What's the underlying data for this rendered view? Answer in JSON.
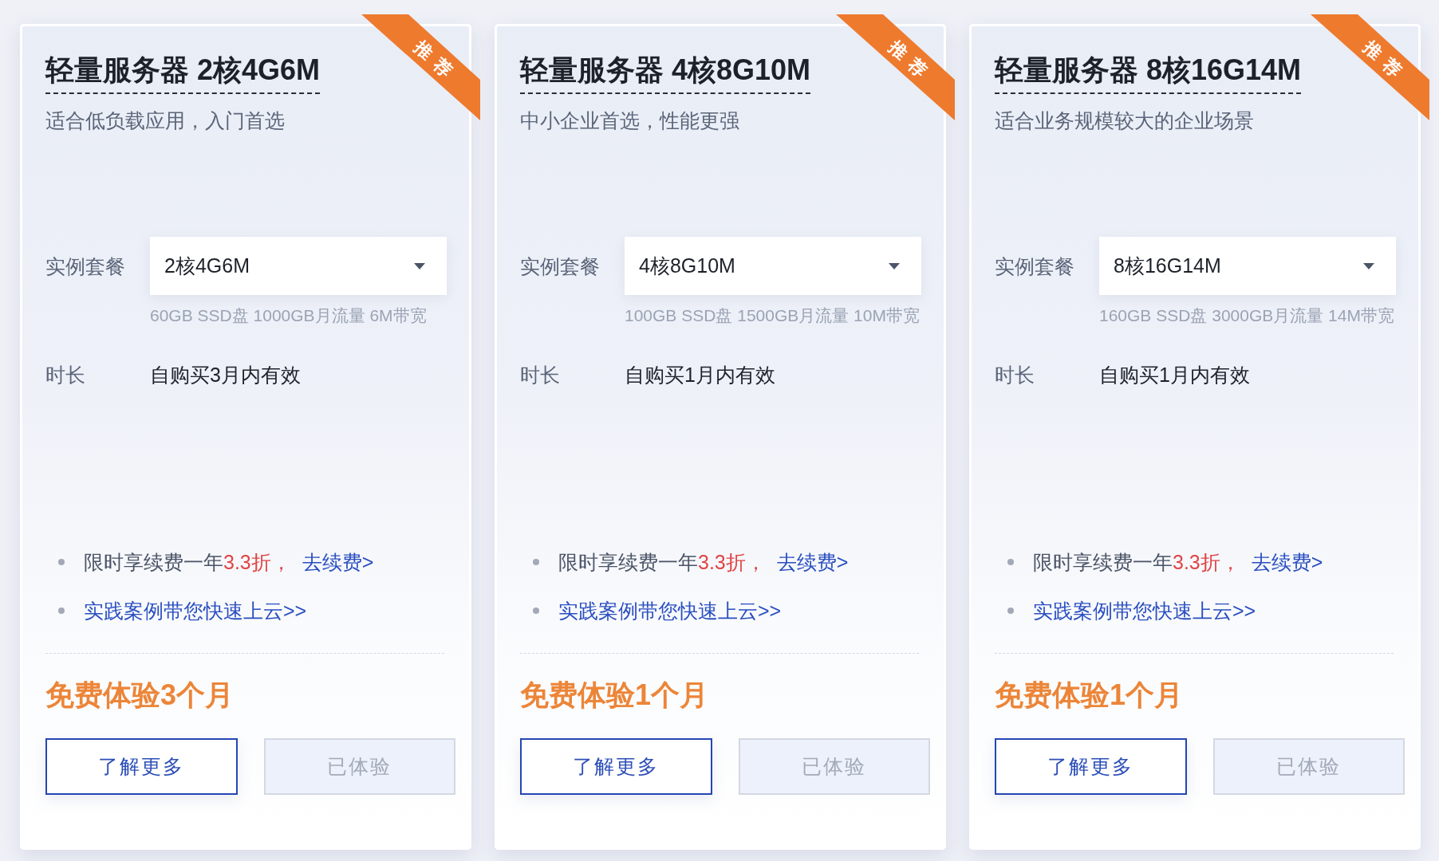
{
  "plans": [
    {
      "title": "轻量服务器 2核4G6M",
      "badge": "推荐",
      "subtitle": "适合低负载应用，入门首选",
      "package": {
        "label": "实例套餐",
        "value": "2核4G6M",
        "note": "60GB SSD盘 1000GB月流量 6M带宽"
      },
      "duration": {
        "label": "时长",
        "value": "自购买3月内有效"
      },
      "perks": [
        {
          "text": "限时享续费一年",
          "highlight": "3.3折，",
          "link": "去续费>"
        },
        {
          "link": "实践案例带您快速上云>>"
        }
      ],
      "offer": "免费体验3个月",
      "buttons": [
        {
          "label": "了解更多",
          "disabled": false
        },
        {
          "label": "已体验",
          "disabled": true
        }
      ]
    },
    {
      "title": "轻量服务器 4核8G10M",
      "badge": "推荐",
      "subtitle": "中小企业首选，性能更强",
      "package": {
        "label": "实例套餐",
        "value": "4核8G10M",
        "note": "100GB SSD盘 1500GB月流量 10M带宽"
      },
      "duration": {
        "label": "时长",
        "value": "自购买1月内有效"
      },
      "perks": [
        {
          "text": "限时享续费一年",
          "highlight": "3.3折，",
          "link": "去续费>"
        },
        {
          "link": "实践案例带您快速上云>>"
        }
      ],
      "offer": "免费体验1个月",
      "buttons": [
        {
          "label": "了解更多",
          "disabled": false
        },
        {
          "label": "已体验",
          "disabled": true
        }
      ]
    },
    {
      "title": "轻量服务器 8核16G14M",
      "badge": "推荐",
      "subtitle": "适合业务规模较大的企业场景",
      "package": {
        "label": "实例套餐",
        "value": "8核16G14M",
        "note": "160GB SSD盘 3000GB月流量 14M带宽"
      },
      "duration": {
        "label": "时长",
        "value": "自购买1月内有效"
      },
      "perks": [
        {
          "text": "限时享续费一年",
          "highlight": "3.3折，",
          "link": "去续费>"
        },
        {
          "link": "实践案例带您快速上云>>"
        }
      ],
      "offer": "免费体验1个月",
      "buttons": [
        {
          "label": "了解更多",
          "disabled": false
        },
        {
          "label": "已体验",
          "disabled": true
        }
      ]
    }
  ]
}
